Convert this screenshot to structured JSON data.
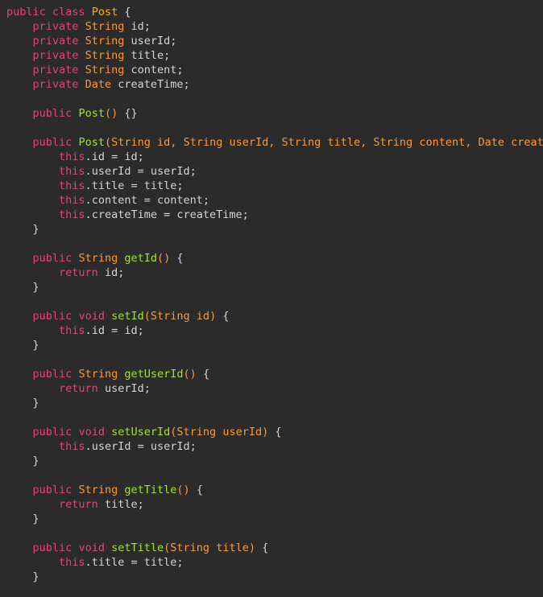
{
  "theme": {
    "background": "#2b2b2b",
    "keyword_color": "#e0457b",
    "type_color": "#ff9933",
    "function_color": "#a6e22e",
    "default_color": "#d4d4d4"
  },
  "code_lines": [
    "public class Post {",
    "    private String id;",
    "    private String userId;",
    "    private String title;",
    "    private String content;",
    "    private Date createTime;",
    "",
    "    public Post() {}",
    "",
    "    public Post(String id, String userId, String title, String content, Date create",
    "        this.id = id;",
    "        this.userId = userId;",
    "        this.title = title;",
    "        this.content = content;",
    "        this.createTime = createTime;",
    "    }",
    "",
    "    public String getId() {",
    "        return id;",
    "    }",
    "",
    "    public void setId(String id) {",
    "        this.id = id;",
    "    }",
    "",
    "    public String getUserId() {",
    "        return userId;",
    "    }",
    "",
    "    public void setUserId(String userId) {",
    "        this.userId = userId;",
    "    }",
    "",
    "    public String getTitle() {",
    "        return title;",
    "    }",
    "",
    "    public void setTitle(String title) {",
    "        this.title = title;",
    "    }"
  ]
}
